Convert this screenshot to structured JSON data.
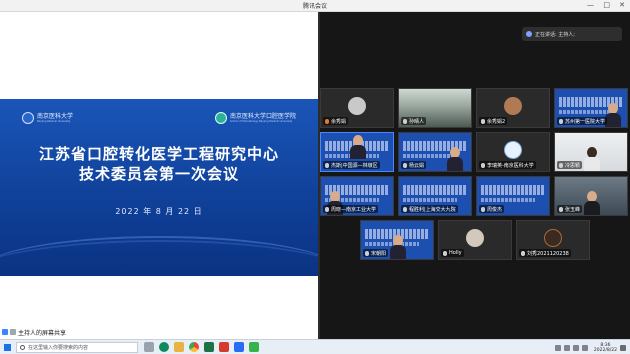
{
  "window": {
    "title": "腾讯会议",
    "controls": [
      "—",
      "□",
      "✕"
    ]
  },
  "slide": {
    "logo_left": "南京医科大学",
    "logo_left_sub": "Nanjing Medical University",
    "logo_right": "南京医科大学口腔医学院",
    "logo_right_sub": "School of Stomatology Nanjing Medical University",
    "title_line1": "江苏省口腔转化医学工程研究中心",
    "title_line2": "技术委员会第一次会议",
    "date": "2022 年 8 月 22 日"
  },
  "share_status": "主持人的屏幕共享",
  "speaking": "正在讲话: 主持人;",
  "participants": [
    {
      "name": "余秀娟",
      "kind": "avatar",
      "color": "#c9c9c9"
    },
    {
      "name": "孙晴人",
      "kind": "room"
    },
    {
      "name": "余秀娟2",
      "kind": "avatar",
      "color": "#b07a55"
    },
    {
      "name": "苏州第一医院大学",
      "kind": "slide"
    },
    {
      "name": "杰斯|中国源—林墩区",
      "kind": "slide-person"
    },
    {
      "name": "杨云娟",
      "kind": "slide"
    },
    {
      "name": "李瑞英-南京医科大学",
      "kind": "avatar",
      "color": "#e6f2ff"
    },
    {
      "name": "冷思颖",
      "kind": "person-light"
    },
    {
      "name": "周晓—南京工业大学",
      "kind": "slide"
    },
    {
      "name": "程胜利|上海交大九院",
      "kind": "slide"
    },
    {
      "name": "周俊杰",
      "kind": "slide"
    },
    {
      "name": "张玉峰",
      "kind": "person-dark"
    },
    {
      "name": "宋朝阳",
      "kind": "slide-person2"
    },
    {
      "name": "Holly",
      "kind": "avatar",
      "color": "#d2c8bc"
    },
    {
      "name": "刘秀2021120238",
      "kind": "avatar",
      "color": "#3b2a1f"
    }
  ],
  "taskbar": {
    "search_placeholder": "在这里输入你要搜索的内容",
    "time": "8:36",
    "date": "2022/8/22",
    "apps": [
      "task-view",
      "edge",
      "file-explorer",
      "chrome",
      "excel",
      "pdf",
      "tencent-meeting",
      "wechat"
    ]
  }
}
